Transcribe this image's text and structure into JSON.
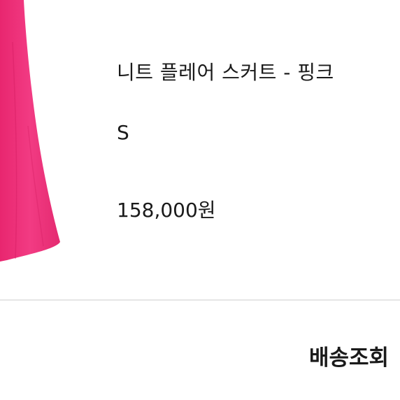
{
  "product": {
    "name": "니트 플레어 스커트 - 핑크",
    "option": "S",
    "price": "158,000원",
    "image_color": "#f0357e"
  },
  "actions": {
    "track_delivery_label": "배송조회"
  }
}
